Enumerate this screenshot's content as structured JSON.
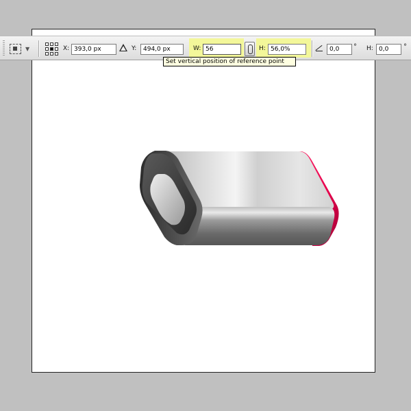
{
  "options_bar": {
    "x_label": "X:",
    "x_value": "393,0 px",
    "y_label": "Y:",
    "y_value": "494,0 px",
    "w_label": "W:",
    "w_value": "56",
    "h_label": "H:",
    "h_value": "56,0%",
    "angle_value": "0,0",
    "angle_unit": "°",
    "hskew_label": "H:",
    "hskew_value": "0,0"
  },
  "tooltip": "Set vertical position of reference point",
  "colors": {
    "highlight": "#f3f79a",
    "accent_pink": "#e6004c",
    "canvas": "#ffffff",
    "workspace": "#c0c0c0"
  },
  "icons": [
    "tool-preset-icon",
    "reference-point-icon",
    "delta-icon",
    "link-icon",
    "angle-icon"
  ]
}
